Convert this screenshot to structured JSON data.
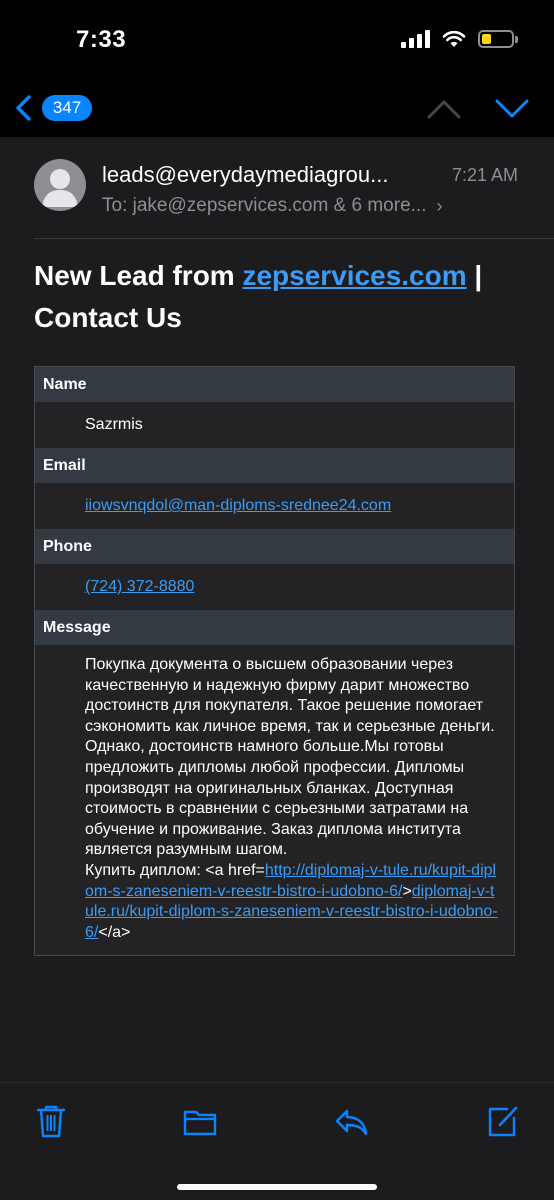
{
  "status": {
    "time": "7:33"
  },
  "nav": {
    "unread_count": "347"
  },
  "email": {
    "sender": "leads@everydaymediagrou...",
    "time": "7:21 AM",
    "to_label": "To:",
    "to_value": "jake@zepservices.com & 6 more...",
    "subject_prefix": "New Lead from ",
    "subject_link": "zepservices.com",
    "subject_suffix": " | Contact Us"
  },
  "lead": {
    "name_label": "Name",
    "name_value": "Sazrmis",
    "email_label": "Email",
    "email_value": "iiowsvnqdol@man-diploms-srednee24.com",
    "phone_label": "Phone",
    "phone_value": "(724) 372-8880",
    "message_label": "Message",
    "message_text": "Покупка документа о высшем образовании через качественную и надежную фирму дарит множество достоинств для покупателя. Такое решение помогает сэкономить как личное время, так и серьезные деньги. Однако, достоинств намного больше.Мы готовы предложить дипломы любой профессии. Дипломы производят на оригинальных бланках. Доступная стоимость в сравнении с серьезными затратами на обучение и проживание. Заказ диплома института является разумным шагом.",
    "buy_prefix": "Купить диплом: <a href=",
    "buy_link1": "http://diplomaj-v-tule.ru/kupit-diplom-s-zaneseniem-v-reestr-bistro-i-udobno-6/",
    "buy_mid": ">",
    "buy_link2": "diplomaj-v-tule.ru/kupit-diplom-s-zaneseniem-v-reestr-bistro-i-udobno-6/",
    "buy_suffix": "</a>"
  },
  "colors": {
    "accent": "#0a84ff",
    "link": "#3b9cf5",
    "panel": "#1c1c1e",
    "header_row": "#333a42"
  }
}
